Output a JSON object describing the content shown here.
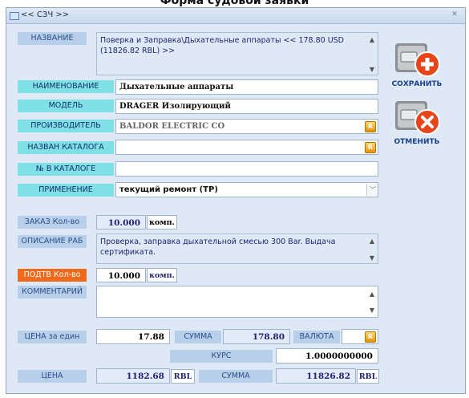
{
  "header": {
    "caption": "Форма судовой заявки"
  },
  "window": {
    "title": "<< СЗЧ >>",
    "close_glyph": "✕"
  },
  "labels": {
    "name": "НАЗВАНИЕ",
    "item": "НАИМЕНОВАНИЕ",
    "model": "МОДЕЛЬ",
    "maker": "ПРОИЗВОДИТЕЛЬ",
    "catalog": "НАЗВАН КАТАЛОГА",
    "catno": "№ В КАТАЛОГЕ",
    "usage": "ПРИМЕНЕНИЕ",
    "order_qty": "ЗАКАЗ Кол-во",
    "work_desc": "ОПИСАНИЕ РАБ",
    "confirm_qty": "ПОДТВ Кол-во",
    "comment": "КОММЕНТАРИЙ",
    "unit_price": "ЦЕНА за един",
    "sum": "СУММА",
    "currency": "ВАЛЮТА",
    "rate": "КУРС",
    "price": "ЦЕНА",
    "sum2": "СУММА"
  },
  "fields": {
    "name_text": "Поверка и Заправка\\Дыхательные аппараты << 178.80 USD (11826.82 RBL) >>",
    "item": "Дыхательные аппараты",
    "model": "DRAGER Изолирующий",
    "maker": "BALDOR ELECTRIC CO",
    "catalog": "",
    "catno": "",
    "usage": "текущий ремонт (ТР)",
    "order_qty": "10.000",
    "order_unit": "комп.",
    "work_desc": "Проверка, заправка дыхательной смесью 300 Bar. Выдача сертификата.",
    "confirm_qty": "10.000",
    "confirm_unit": "комп.",
    "comment": "",
    "unit_price": "17.88",
    "sum": "178.80",
    "currency": "",
    "rate": "1.0000000000",
    "price": "1182.68",
    "price_cur": "RBL",
    "sum2": "11826.82",
    "sum2_cur": "RBL"
  },
  "buttons": {
    "save": "СОХРАНИТЬ",
    "cancel": "ОТМЕНИТЬ",
    "r_glyph": "R"
  },
  "colors": {
    "save_accent": "#e8441b",
    "cancel_accent": "#e8441b",
    "label_cyan": "#7fe0e6",
    "label_orange": "#f06a1c"
  }
}
